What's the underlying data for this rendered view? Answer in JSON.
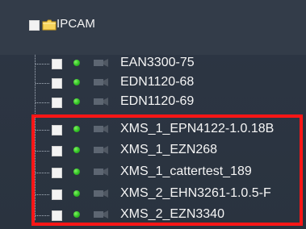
{
  "tree": {
    "root_label": "IPCAM",
    "items": [
      {
        "label": "EAN3300-75",
        "status": "online"
      },
      {
        "label": "EDN1120-68",
        "status": "online"
      },
      {
        "label": "EDN1120-69",
        "status": "online"
      },
      {
        "label": "XMS_1_EPN4122-1.0.18B",
        "status": "online"
      },
      {
        "label": "XMS_1_EZN268",
        "status": "online"
      },
      {
        "label": "XMS_1_cattertest_189",
        "status": "online"
      },
      {
        "label": "XMS_2_EHN3261-1.0.5-F",
        "status": "online"
      },
      {
        "label": "XMS_2_EZN3340",
        "status": "online"
      }
    ]
  },
  "colors": {
    "background": "#2b3440",
    "text": "#f5f5f5",
    "online_dot": "#31c025",
    "highlight": "#ff1616"
  }
}
